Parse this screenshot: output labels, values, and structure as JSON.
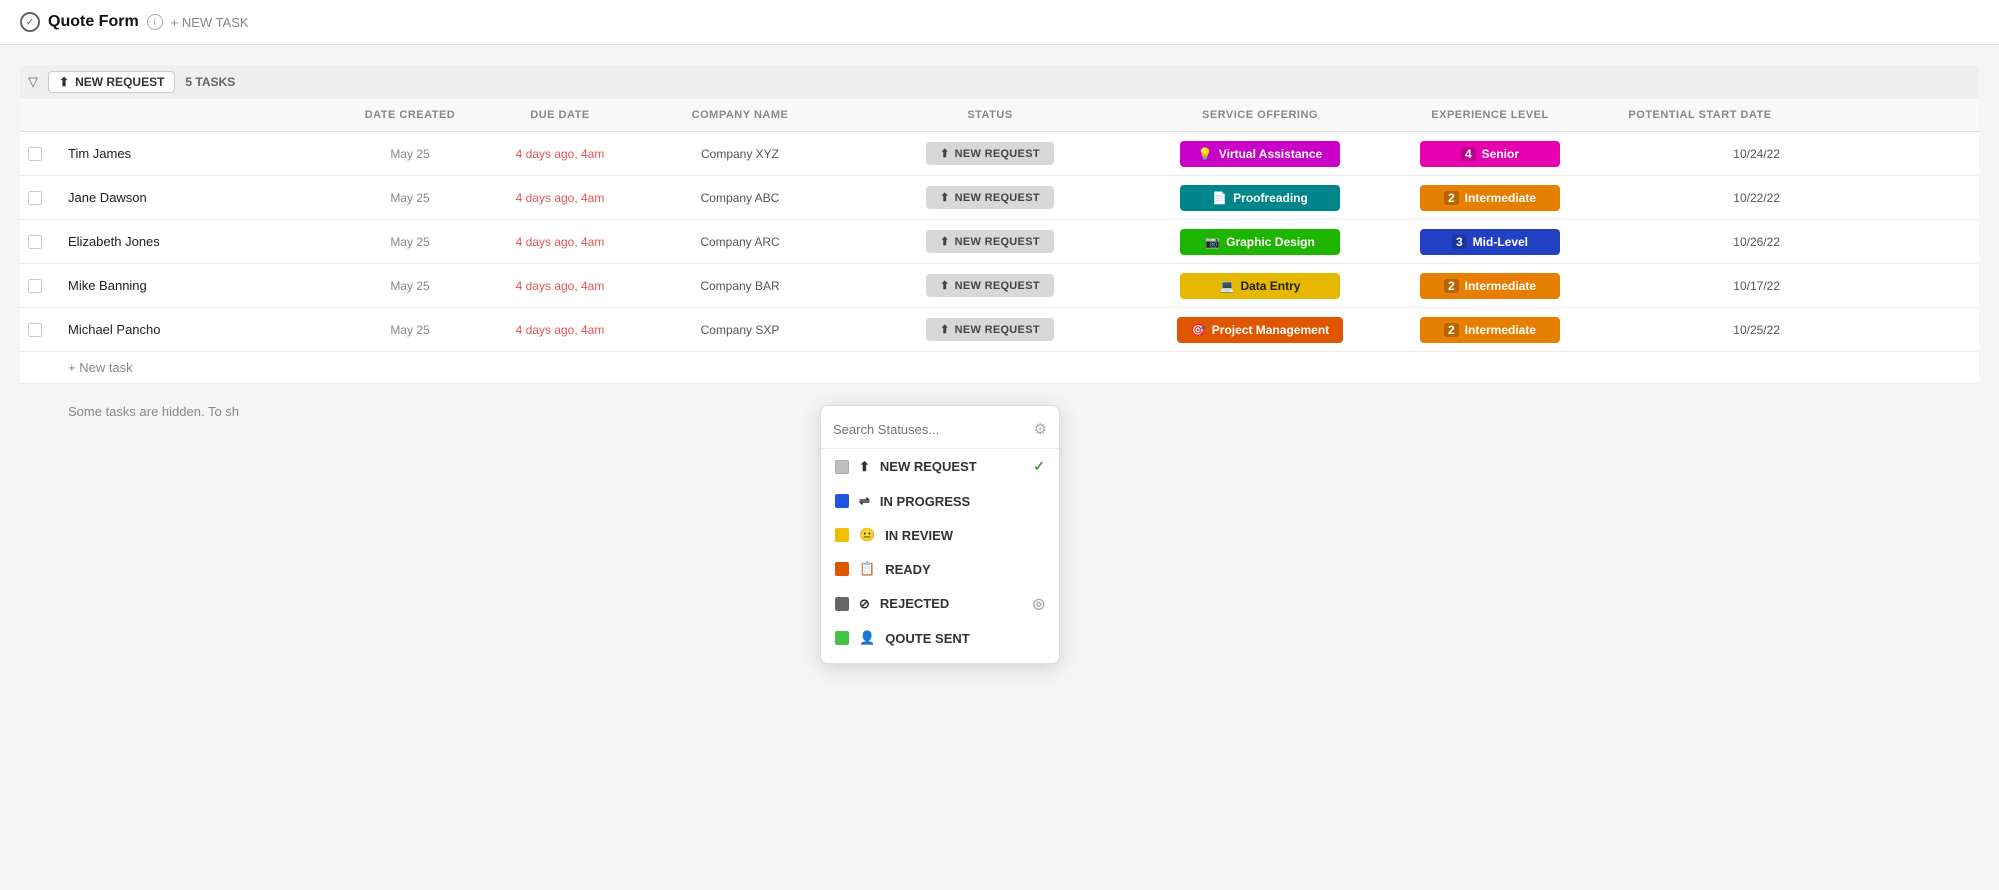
{
  "header": {
    "title": "Quote Form",
    "new_task_label": "+ NEW TASK"
  },
  "group": {
    "toggle_icon": "▽",
    "label": "NEW REQUEST",
    "task_count": "5 TASKS"
  },
  "columns": {
    "headers": [
      "",
      "",
      "DATE CREATED",
      "DUE DATE",
      "COMPANY NAME",
      "STATUS",
      "SERVICE OFFERING",
      "EXPERIENCE LEVEL",
      "POTENTIAL START DATE",
      ""
    ]
  },
  "tasks": [
    {
      "id": 1,
      "name": "Tim James",
      "date_created": "May 25",
      "due_date": "4 days ago, 4am",
      "company": "Company XYZ",
      "status": "NEW REQUEST",
      "service": "Virtual Assistance",
      "service_class": "service-virtual",
      "service_icon": "💡",
      "experience": "Senior",
      "exp_num": "4",
      "exp_class": "exp-senior",
      "potential_date": "10/24/22"
    },
    {
      "id": 2,
      "name": "Jane Dawson",
      "date_created": "May 25",
      "due_date": "4 days ago, 4am",
      "company": "Company ABC",
      "status": "NEW REQUEST",
      "service": "Proofreading",
      "service_class": "service-proofreading",
      "service_icon": "📄",
      "experience": "Intermediate",
      "exp_num": "2",
      "exp_class": "exp-intermediate",
      "potential_date": "10/22/22"
    },
    {
      "id": 3,
      "name": "Elizabeth Jones",
      "date_created": "May 25",
      "due_date": "4 days ago, 4am",
      "company": "Company ARC",
      "status": "NEW REQUEST",
      "service": "Graphic Design",
      "service_class": "service-graphic",
      "service_icon": "📷",
      "experience": "Mid-Level",
      "exp_num": "3",
      "exp_class": "exp-midlevel",
      "potential_date": "10/26/22"
    },
    {
      "id": 4,
      "name": "Mike Banning",
      "date_created": "May 25",
      "due_date": "4 days ago, 4am",
      "company": "Company BAR",
      "status": "NEW REQUEST",
      "service": "Data Entry",
      "service_class": "service-data-entry",
      "service_icon": "💻",
      "experience": "Intermediate",
      "exp_num": "2",
      "exp_class": "exp-intermediate",
      "potential_date": "10/17/22"
    },
    {
      "id": 5,
      "name": "Michael Pancho",
      "date_created": "May 25",
      "due_date": "4 days ago, 4am",
      "company": "Company SXP",
      "status": "NEW REQUEST",
      "service": "Project Management",
      "service_class": "service-project",
      "service_icon": "🎯",
      "experience": "Intermediate",
      "exp_num": "2",
      "exp_class": "exp-intermediate",
      "potential_date": "10/25/22"
    }
  ],
  "new_task_label": "+ New task",
  "hidden_tasks_note": "Some tasks are hidden. To sh",
  "dropdown": {
    "search_placeholder": "Search Statuses...",
    "items": [
      {
        "label": "NEW REQUEST",
        "dot_class": "dot-gray",
        "icon": "⬆",
        "checked": true,
        "circle_checked": false
      },
      {
        "label": "IN PROGRESS",
        "dot_class": "dot-blue",
        "icon": "⇌",
        "checked": false,
        "circle_checked": false
      },
      {
        "label": "IN REVIEW",
        "dot_class": "dot-yellow",
        "icon": "😐",
        "checked": false,
        "circle_checked": false
      },
      {
        "label": "READY",
        "dot_class": "dot-orange",
        "icon": "📋",
        "checked": false,
        "circle_checked": false
      },
      {
        "label": "REJECTED",
        "dot_class": "dot-darkgray",
        "icon": "⊘",
        "checked": false,
        "circle_checked": true
      },
      {
        "label": "QOUTE SENT",
        "dot_class": "dot-green",
        "icon": "👤",
        "checked": false,
        "circle_checked": false
      }
    ]
  }
}
